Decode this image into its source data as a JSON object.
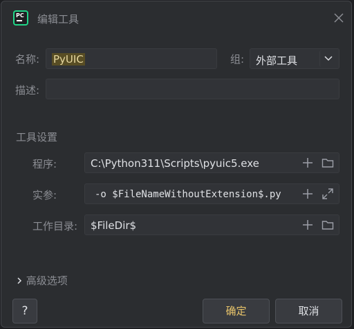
{
  "window": {
    "title": "编辑工具"
  },
  "form": {
    "name_label": "名称:",
    "name_value": "PyUIC",
    "group_label": "组:",
    "group_value": "外部工具",
    "desc_label": "描述:",
    "desc_value": ""
  },
  "tool_settings": {
    "section_label": "工具设置",
    "program_label": "程序:",
    "program_value": "C:\\Python311\\Scripts\\pyuic5.exe",
    "args_label": "实参:",
    "args_value": "-o $FileNameWithoutExtension$.py",
    "workdir_label": "工作目录:",
    "workdir_value": "$FileDir$"
  },
  "advanced": {
    "label": "高级选项"
  },
  "buttons": {
    "help": "?",
    "ok": "确定",
    "cancel": "取消"
  },
  "icons": {
    "app": "pycharm-logo-icon",
    "close": "close-icon",
    "add": "plus-icon",
    "browse": "folder-icon",
    "expand": "expand-icon",
    "combo": "chevron-down-icon",
    "advanced": "chevron-right-icon"
  },
  "colors": {
    "background": "#2b2d30",
    "field": "#313337",
    "accent": "#e8c46a",
    "highlight": "#584d24"
  }
}
